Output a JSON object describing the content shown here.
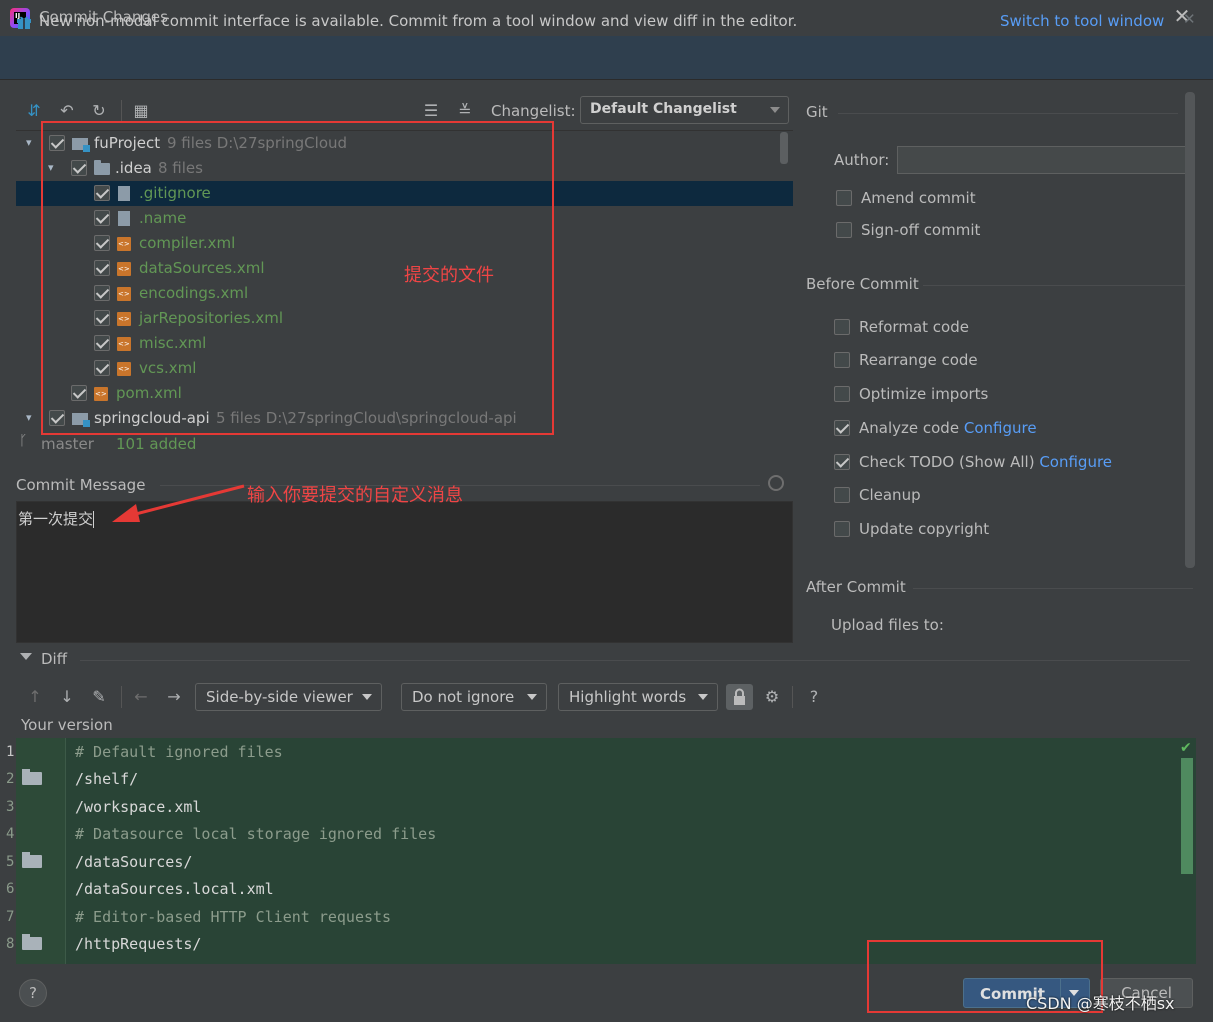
{
  "window": {
    "title": "Commit Changes",
    "logo_text": "IJ"
  },
  "banner": {
    "text": "New non-modal commit interface is available. Commit from a tool window and view diff in the editor.",
    "link": "Switch to tool window"
  },
  "toolbar": {
    "changelist_label": "Changelist:",
    "changelist_value": "Default Changelist"
  },
  "tree": [
    {
      "name": "fuProject",
      "meta": "9 files  D:\\27springCloud",
      "kind": "project"
    },
    {
      "name": ".idea",
      "meta": "8 files",
      "kind": "folder"
    },
    {
      "name": ".gitignore",
      "meta": "",
      "kind": "file"
    },
    {
      "name": ".name",
      "meta": "",
      "kind": "file"
    },
    {
      "name": "compiler.xml",
      "meta": "",
      "kind": "xml"
    },
    {
      "name": "dataSources.xml",
      "meta": "",
      "kind": "xml"
    },
    {
      "name": "encodings.xml",
      "meta": "",
      "kind": "xml"
    },
    {
      "name": "jarRepositories.xml",
      "meta": "",
      "kind": "xml"
    },
    {
      "name": "misc.xml",
      "meta": "",
      "kind": "xml"
    },
    {
      "name": "vcs.xml",
      "meta": "",
      "kind": "xml"
    },
    {
      "name": "pom.xml",
      "meta": "",
      "kind": "xml"
    },
    {
      "name": "springcloud-api",
      "meta": "5 files  D:\\27springCloud\\springcloud-api",
      "kind": "project"
    }
  ],
  "status": {
    "branch": "master",
    "added": "101 added"
  },
  "commit_message": {
    "label": "Commit Message",
    "value": "第一次提交"
  },
  "git": {
    "title": "Git",
    "author_label": "Author:",
    "author_value": "",
    "amend": "Amend commit",
    "signoff": "Sign-off commit"
  },
  "before_commit": {
    "title": "Before Commit",
    "reformat": "Reformat code",
    "rearrange": "Rearrange code",
    "optimize": "Optimize imports",
    "analyze": "Analyze code",
    "analyze_link": "Configure",
    "todo": "Check TODO (Show All)",
    "todo_link": "Configure",
    "cleanup": "Cleanup",
    "copyright": "Update copyright"
  },
  "after_commit": {
    "title": "After Commit",
    "upload": "Upload files to:"
  },
  "diff": {
    "title": "Diff",
    "viewer": "Side-by-side viewer",
    "ignore": "Do not ignore",
    "highlight": "Highlight words",
    "help": "?",
    "your_version": "Your version",
    "lines": [
      {
        "n": "1",
        "text": "# Default ignored files",
        "comment": true,
        "folder": false
      },
      {
        "n": "2",
        "text": "/shelf/",
        "comment": false,
        "folder": true
      },
      {
        "n": "3",
        "text": "/workspace.xml",
        "comment": false,
        "folder": false
      },
      {
        "n": "4",
        "text": "# Datasource local storage ignored files",
        "comment": true,
        "folder": false
      },
      {
        "n": "5",
        "text": "/dataSources/",
        "comment": false,
        "folder": true
      },
      {
        "n": "6",
        "text": "/dataSources.local.xml",
        "comment": false,
        "folder": false
      },
      {
        "n": "7",
        "text": "# Editor-based HTTP Client requests",
        "comment": true,
        "folder": false
      },
      {
        "n": "8",
        "text": "/httpRequests/",
        "comment": false,
        "folder": true
      }
    ]
  },
  "buttons": {
    "help": "?",
    "commit": "Commit",
    "cancel": "Cancel"
  },
  "annotations": {
    "files": "提交的文件",
    "message": "输入你要提交的自定义消息"
  },
  "watermark": "CSDN @寒枝不栖sx",
  "colors": {
    "accent": "#589df6",
    "commit_button": "#365880",
    "annotation_red": "#e53935",
    "added_green": "#629755"
  }
}
